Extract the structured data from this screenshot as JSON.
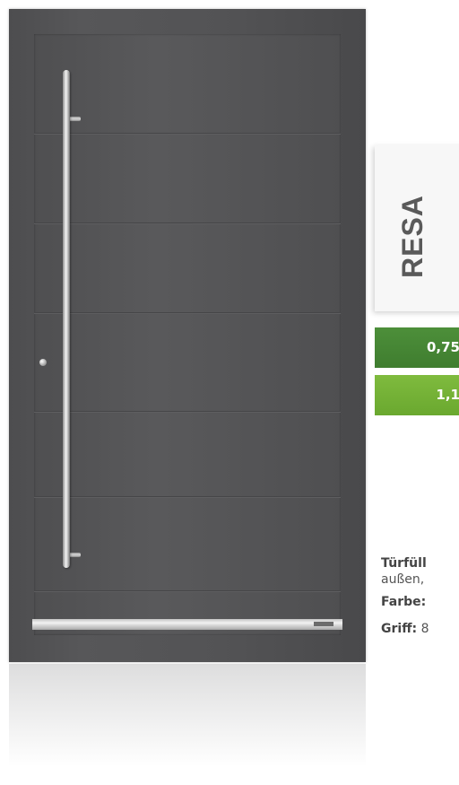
{
  "model": {
    "name": "RESA"
  },
  "u_values": [
    "0,75",
    "1,1"
  ],
  "specs": {
    "line1_label": "Türfüll",
    "line2_text": "außen,",
    "color_label": "Farbe:",
    "handle_label": "Griff:",
    "handle_value": "8"
  },
  "colors": {
    "door": "#545456",
    "u_bar_dark": "#3f7d2f",
    "u_bar_light": "#6aa82f"
  }
}
